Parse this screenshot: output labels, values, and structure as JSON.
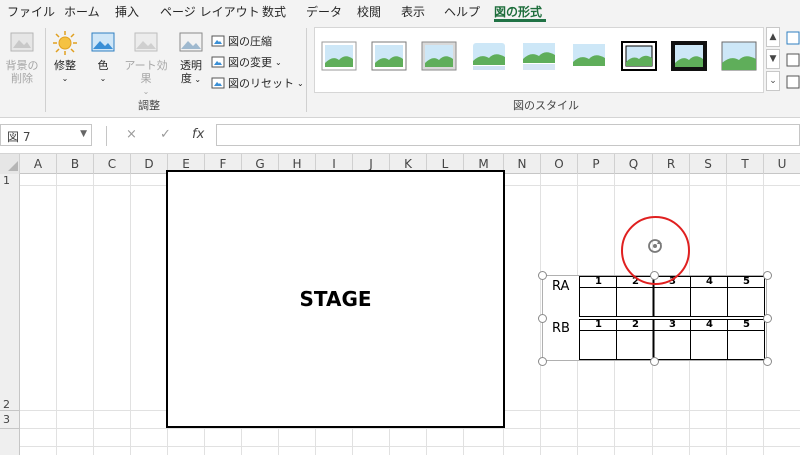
{
  "ribbon": {
    "tabs": [
      {
        "label": "ファイル",
        "active": false
      },
      {
        "label": "ホーム",
        "active": false
      },
      {
        "label": "挿入",
        "active": false
      },
      {
        "label": "ページ レイアウト",
        "active": false
      },
      {
        "label": "数式",
        "active": false
      },
      {
        "label": "データ",
        "active": false
      },
      {
        "label": "校閲",
        "active": false
      },
      {
        "label": "表示",
        "active": false
      },
      {
        "label": "ヘルプ",
        "active": false
      },
      {
        "label": "図の形式",
        "active": true
      }
    ],
    "adjust_group": {
      "remove_bg_line1": "背景の",
      "remove_bg_line2": "削除",
      "corrections": "修整",
      "color": "色",
      "artistic_effects": "アート効果",
      "transparency_line1": "透明",
      "transparency_line2": "度",
      "compress": "図の圧縮",
      "change_picture": "図の変更",
      "reset_picture": "図のリセット",
      "label": "調整"
    },
    "styles_group": {
      "label": "図のスタイル",
      "thumb_count": 9
    }
  },
  "formula_bar": {
    "name_box": "図 7",
    "cancel_icon": "×",
    "enter_icon": "✓",
    "fx_label": "fx",
    "formula_value": ""
  },
  "sheet": {
    "columns": [
      "A",
      "B",
      "C",
      "D",
      "E",
      "F",
      "G",
      "H",
      "I",
      "J",
      "K",
      "L",
      "M",
      "N",
      "O",
      "P",
      "Q",
      "R",
      "S",
      "T",
      "U"
    ],
    "rows": [
      "1",
      "2",
      "3"
    ]
  },
  "stage_shape": {
    "label": "STAGE"
  },
  "seat_picture": {
    "rows": [
      {
        "label": "RA",
        "seats": [
          "1",
          "2",
          "3",
          "4",
          "5"
        ]
      },
      {
        "label": "RB",
        "seats": [
          "1",
          "2",
          "3",
          "4",
          "5"
        ]
      }
    ]
  },
  "colors": {
    "accent_green": "#217346",
    "annotation_red": "#e02020"
  }
}
